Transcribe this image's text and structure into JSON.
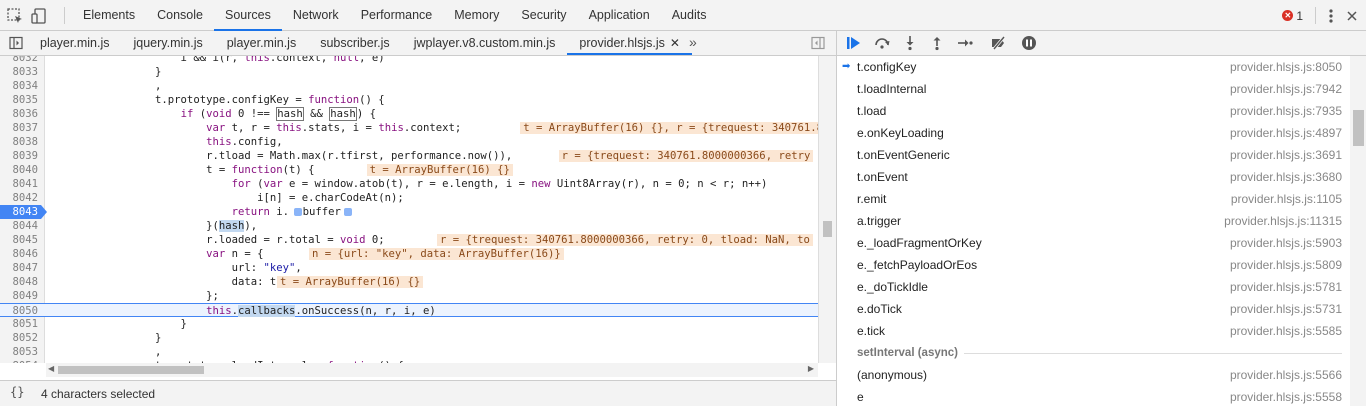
{
  "toolbar": {
    "tabs": [
      "Elements",
      "Console",
      "Sources",
      "Network",
      "Performance",
      "Memory",
      "Security",
      "Application",
      "Audits"
    ],
    "active_tab": "Sources",
    "error_count": "1"
  },
  "file_tabs": [
    {
      "label": "player.min.js"
    },
    {
      "label": "jquery.min.js"
    },
    {
      "label": "player.min.js"
    },
    {
      "label": "subscriber.js"
    },
    {
      "label": "jwplayer.v8.custom.min.js"
    },
    {
      "label": "provider.hlsjs.js"
    }
  ],
  "code": {
    "lines": [
      {
        "n": "8032",
        "text": "                    i && i(r, this.context, null, e)"
      },
      {
        "n": "8033",
        "text": "                }"
      },
      {
        "n": "8034",
        "text": "                ,"
      },
      {
        "n": "8035",
        "text": "                t.prototype.configKey = function() {"
      },
      {
        "n": "8036",
        "text": "                    if (void 0 !== hash && hash) {"
      },
      {
        "n": "8037",
        "text": "                        var t, r = this.stats, i = this.context;"
      },
      {
        "n": "8038",
        "text": "                        this.config,"
      },
      {
        "n": "8039",
        "text": "                        r.tload = Math.max(r.tfirst, performance.now()),"
      },
      {
        "n": "8040",
        "text": "                        t = function(t) {"
      },
      {
        "n": "8041",
        "text": "                            for (var e = window.atob(t), r = e.length, i = new Uint8Array(r), n = 0; n < r; n++)"
      },
      {
        "n": "8042",
        "text": "                                i[n] = e.charCodeAt(n);"
      },
      {
        "n": "8043",
        "text": "                            return i."
      },
      {
        "n": "8044",
        "text": "                        }(hash),"
      },
      {
        "n": "8045",
        "text": "                        r.loaded = r.total = void 0;"
      },
      {
        "n": "8046",
        "text": "                        var n = {"
      },
      {
        "n": "8047",
        "text": "                            url: \"key\","
      },
      {
        "n": "8048",
        "text": "                            data: t"
      },
      {
        "n": "8049",
        "text": "                        };"
      },
      {
        "n": "8050",
        "text": "                        this.callbacks.onSuccess(n, r, i, e)"
      },
      {
        "n": "8051",
        "text": "                    }"
      },
      {
        "n": "8052",
        "text": "                }"
      },
      {
        "n": "8053",
        "text": "                ,"
      },
      {
        "n": "8054",
        "text": "                t.prototype.loadInternal = function() {"
      }
    ],
    "buffer_word": "buffer",
    "inline_values": {
      "v8037": "t = ArrayBuffer(16) {}, r = {trequest: 340761.8",
      "v8039": "r = {trequest: 340761.8000000366, retry",
      "v8040": "t = ArrayBuffer(16) {}",
      "v8045": "r = {trequest: 340761.8000000366, retry: 0, tload: NaN, to",
      "v8046": "n = {url: \"key\", data: ArrayBuffer(16)}",
      "v8048": "t = ArrayBuffer(16) {}"
    }
  },
  "status": {
    "pretty_print": "{}",
    "selection": "4 characters selected"
  },
  "call_stack": {
    "frames": [
      {
        "fn": "t.configKey",
        "loc": "provider.hlsjs.js:8050"
      },
      {
        "fn": "t.loadInternal",
        "loc": "provider.hlsjs.js:7942"
      },
      {
        "fn": "t.load",
        "loc": "provider.hlsjs.js:7935"
      },
      {
        "fn": "e.onKeyLoading",
        "loc": "provider.hlsjs.js:4897"
      },
      {
        "fn": "t.onEventGeneric",
        "loc": "provider.hlsjs.js:3691"
      },
      {
        "fn": "t.onEvent",
        "loc": "provider.hlsjs.js:3680"
      },
      {
        "fn": "r.emit",
        "loc": "provider.hlsjs.js:1105"
      },
      {
        "fn": "a.trigger",
        "loc": "provider.hlsjs.js:11315"
      },
      {
        "fn": "e._loadFragmentOrKey",
        "loc": "provider.hlsjs.js:5903"
      },
      {
        "fn": "e._fetchPayloadOrEos",
        "loc": "provider.hlsjs.js:5809"
      },
      {
        "fn": "e._doTickIdle",
        "loc": "provider.hlsjs.js:5781"
      },
      {
        "fn": "e.doTick",
        "loc": "provider.hlsjs.js:5731"
      },
      {
        "fn": "e.tick",
        "loc": "provider.hlsjs.js:5585"
      }
    ],
    "async_label": "setInterval (async)",
    "async_frames": [
      {
        "fn": "(anonymous)",
        "loc": "provider.hlsjs.js:5566"
      },
      {
        "fn": "e",
        "loc": "provider.hlsjs.js:5558"
      }
    ]
  },
  "colors": {
    "accent": "#1a73e8",
    "breakpoint": "#4285f4",
    "inline_value_bg": "#fbe6d3",
    "error": "#d93025"
  }
}
